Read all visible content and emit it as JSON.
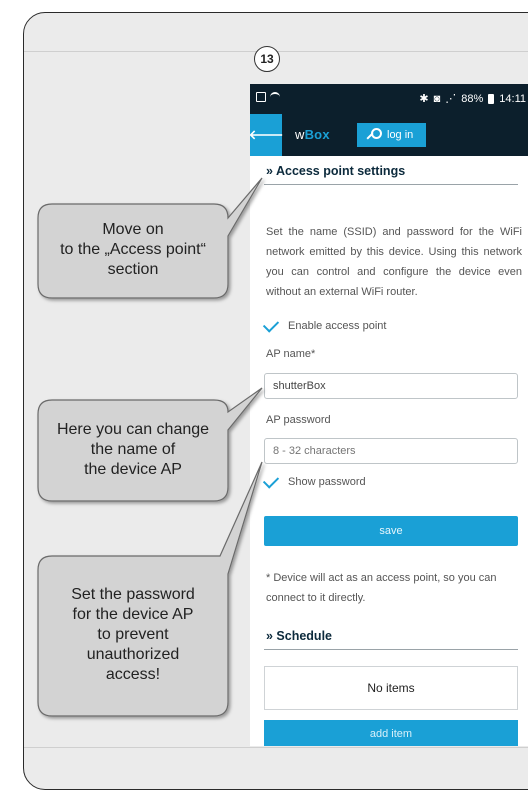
{
  "step_number": "13",
  "status_bar": {
    "right_text": "88%",
    "time": "14:11",
    "icons": [
      "image-icon",
      "wifi-icon",
      "bluetooth-icon",
      "alarm-icon",
      "wifi-signal-icon",
      "signal-icon",
      "battery-icon"
    ]
  },
  "app_bar": {
    "brand_prefix": "w",
    "brand_name": "Box",
    "login_label": "log in",
    "accent_color": "#1aa0d6",
    "bar_color": "#0c1f2c"
  },
  "access_point": {
    "title": "» Access point settings",
    "description": "Set the name (SSID) and password for the WiFi network emitted by this device. Using this network you can control and configure the device even without an external WiFi router.",
    "enable_label": "Enable access point",
    "ap_name_label": "AP name*",
    "ap_name_value": "shutterBox",
    "ap_password_label": "AP password",
    "ap_password_placeholder": "8 - 32 characters",
    "show_password_label": "Show password",
    "save_label": "save",
    "note": "* Device will act as an access point, so you can connect to it directly."
  },
  "schedule": {
    "title": "» Schedule",
    "empty_label": "No items",
    "add_label": "add item"
  },
  "callouts": [
    {
      "lines": [
        "Move on",
        "to the „Access point“",
        "section"
      ]
    },
    {
      "lines": [
        "Here you can change",
        "the name of",
        "the device AP"
      ]
    },
    {
      "lines": [
        "Set the password",
        "for the device AP",
        "to prevent",
        "unauthorized",
        "access!"
      ]
    }
  ]
}
